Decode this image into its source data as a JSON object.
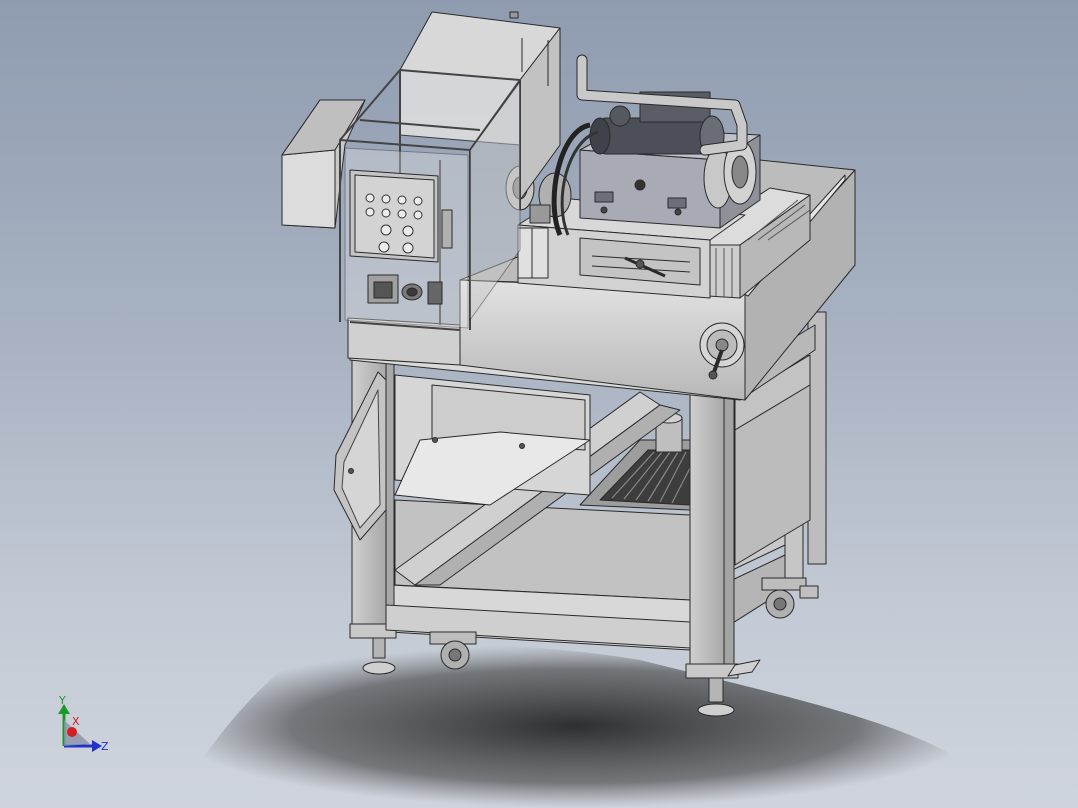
{
  "viewport": {
    "background_top": "#8f9cb0",
    "background_bottom": "#cfd4dc"
  },
  "model": {
    "part_fill": "#d3d3d3",
    "edge_color": "#2a2a2a",
    "shadow_color": "#1a1a1a"
  },
  "triad": {
    "x_label": "X",
    "y_label": "Y",
    "z_label": "Z",
    "x_color": "#d21f1f",
    "y_color": "#1b9a2a",
    "z_color": "#2233cc"
  }
}
